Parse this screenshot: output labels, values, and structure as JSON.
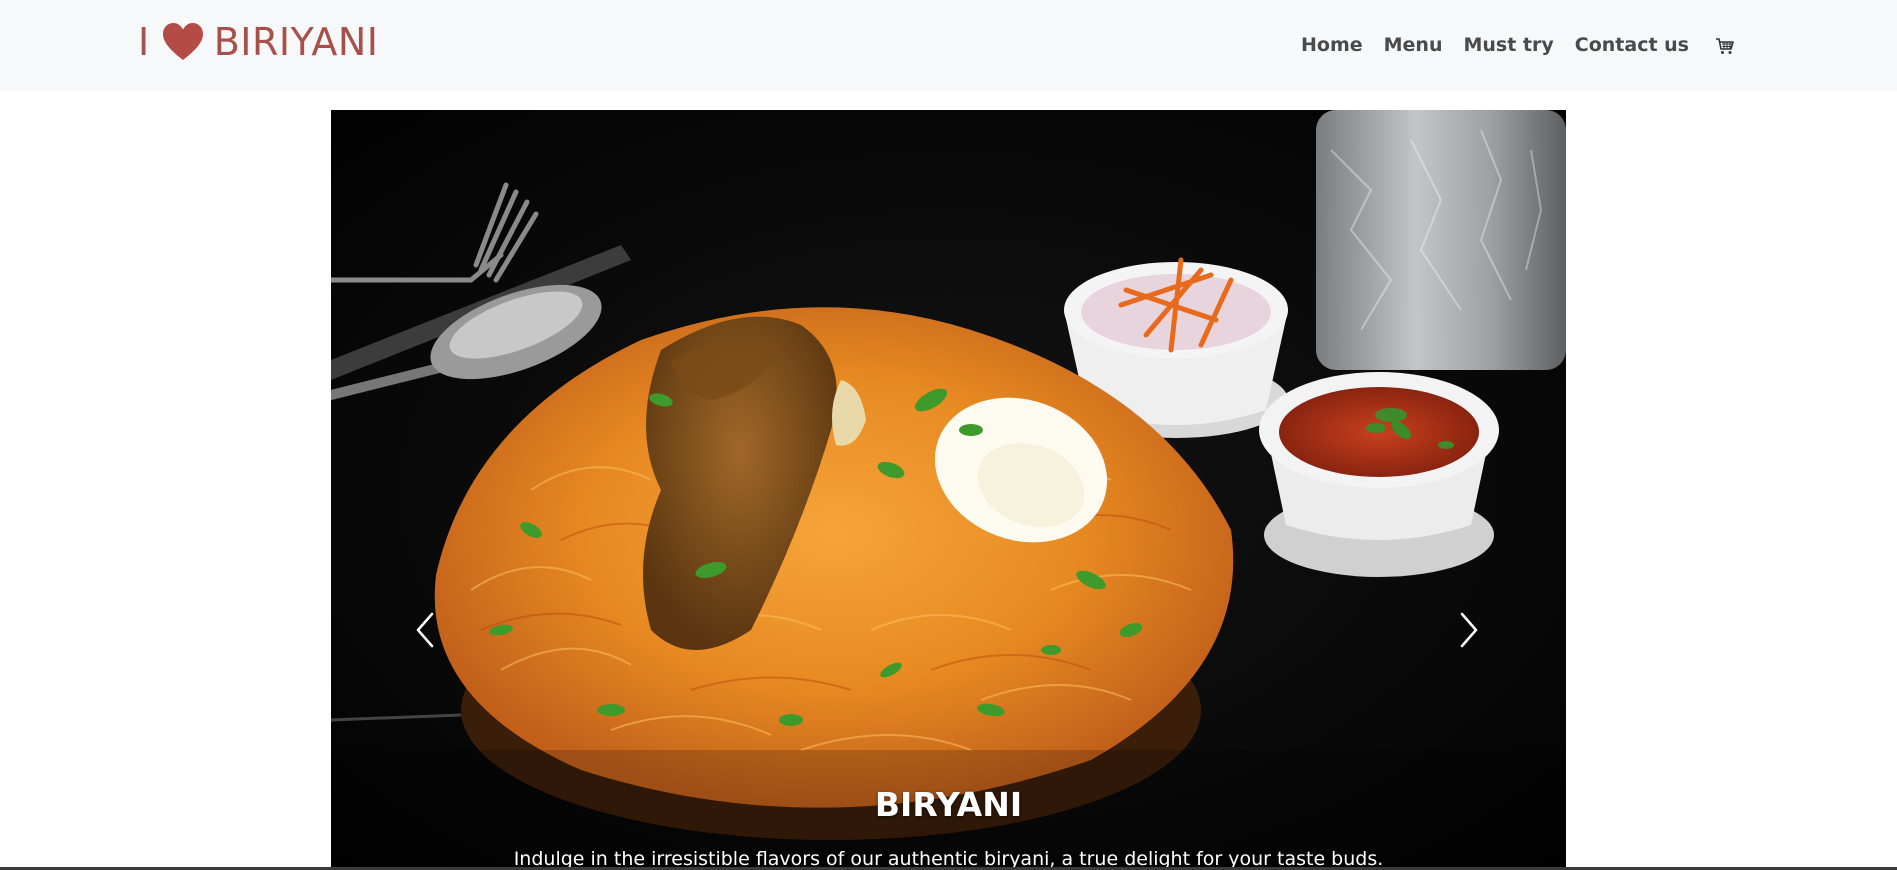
{
  "brand": {
    "prefix": "I",
    "name": "BIRIYANI",
    "icon": "heart-icon",
    "color": "#a8504a"
  },
  "nav": {
    "items": [
      {
        "label": "Home"
      },
      {
        "label": "Menu"
      },
      {
        "label": "Must try"
      },
      {
        "label": "Contact us"
      }
    ],
    "cart_icon": "cart-icon"
  },
  "carousel": {
    "slide_title": "BIRYANI",
    "slide_text": "Indulge in the irresistible flavors of our authentic biryani, a true delight for your taste buds.",
    "prev_icon": "chevron-left-icon",
    "next_icon": "chevron-right-icon"
  }
}
